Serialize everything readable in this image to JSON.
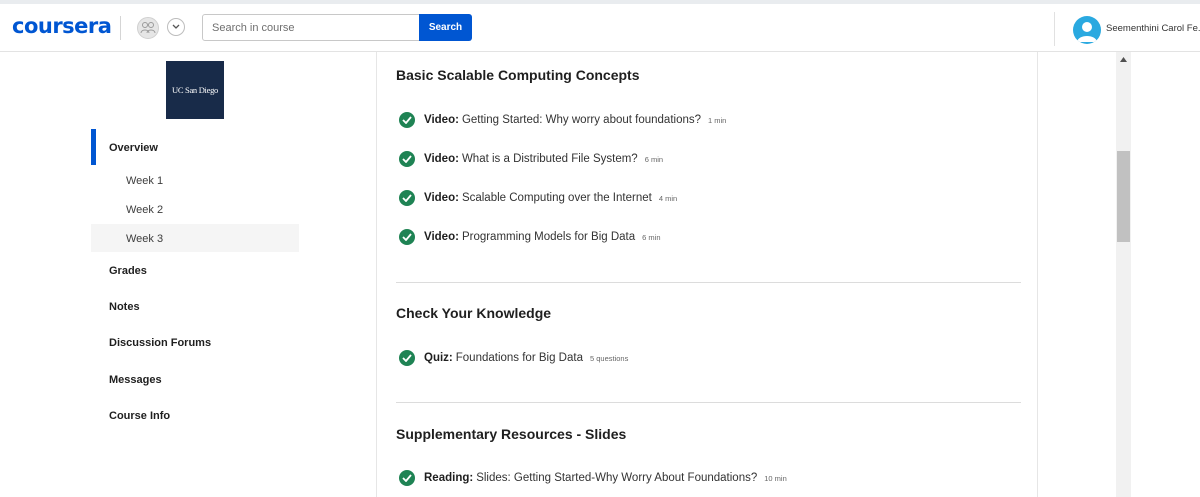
{
  "header": {
    "logo": "coursera",
    "search": {
      "placeholder": "Search in course",
      "value": ""
    },
    "search_button": "Search",
    "user_name": "Seementhini Carol Fe..."
  },
  "sidebar": {
    "partner_logo": "UC San Diego",
    "items": [
      {
        "label": "Overview",
        "active": true
      },
      {
        "label": "Grades"
      },
      {
        "label": "Notes"
      },
      {
        "label": "Discussion Forums"
      },
      {
        "label": "Messages"
      },
      {
        "label": "Course Info"
      }
    ],
    "weeks": [
      {
        "label": "Week 1"
      },
      {
        "label": "Week 2"
      },
      {
        "label": "Week 3",
        "highlighted": true
      }
    ]
  },
  "sections": [
    {
      "title": "Basic Scalable Computing Concepts",
      "items": [
        {
          "type": "Video:",
          "title": "Getting Started: Why worry about foundations?",
          "meta": "1 min",
          "completed": true
        },
        {
          "type": "Video:",
          "title": "What is a Distributed File System?",
          "meta": "6 min",
          "completed": true
        },
        {
          "type": "Video:",
          "title": "Scalable Computing over the Internet",
          "meta": "4 min",
          "completed": true
        },
        {
          "type": "Video:",
          "title": "Programming Models for Big Data",
          "meta": "6 min",
          "completed": true
        }
      ]
    },
    {
      "title": "Check Your Knowledge",
      "items": [
        {
          "type": "Quiz:",
          "title": "Foundations for Big Data",
          "meta": "5 questions",
          "completed": true
        }
      ]
    },
    {
      "title": "Supplementary Resources - Slides",
      "items": [
        {
          "type": "Reading:",
          "title": "Slides: Getting Started-Why Worry About Foundations?",
          "meta": "10 min",
          "completed": true
        }
      ]
    }
  ],
  "colors": {
    "brand": "#0056d2",
    "complete": "#1f8354",
    "partner_bg": "#182b49",
    "avatar": "#2aa9e0"
  },
  "icons": {
    "completed": "check-circle-icon",
    "avatar": "user-avatar-icon",
    "partners": "people-icon",
    "dropdown": "chevron-down-icon"
  }
}
